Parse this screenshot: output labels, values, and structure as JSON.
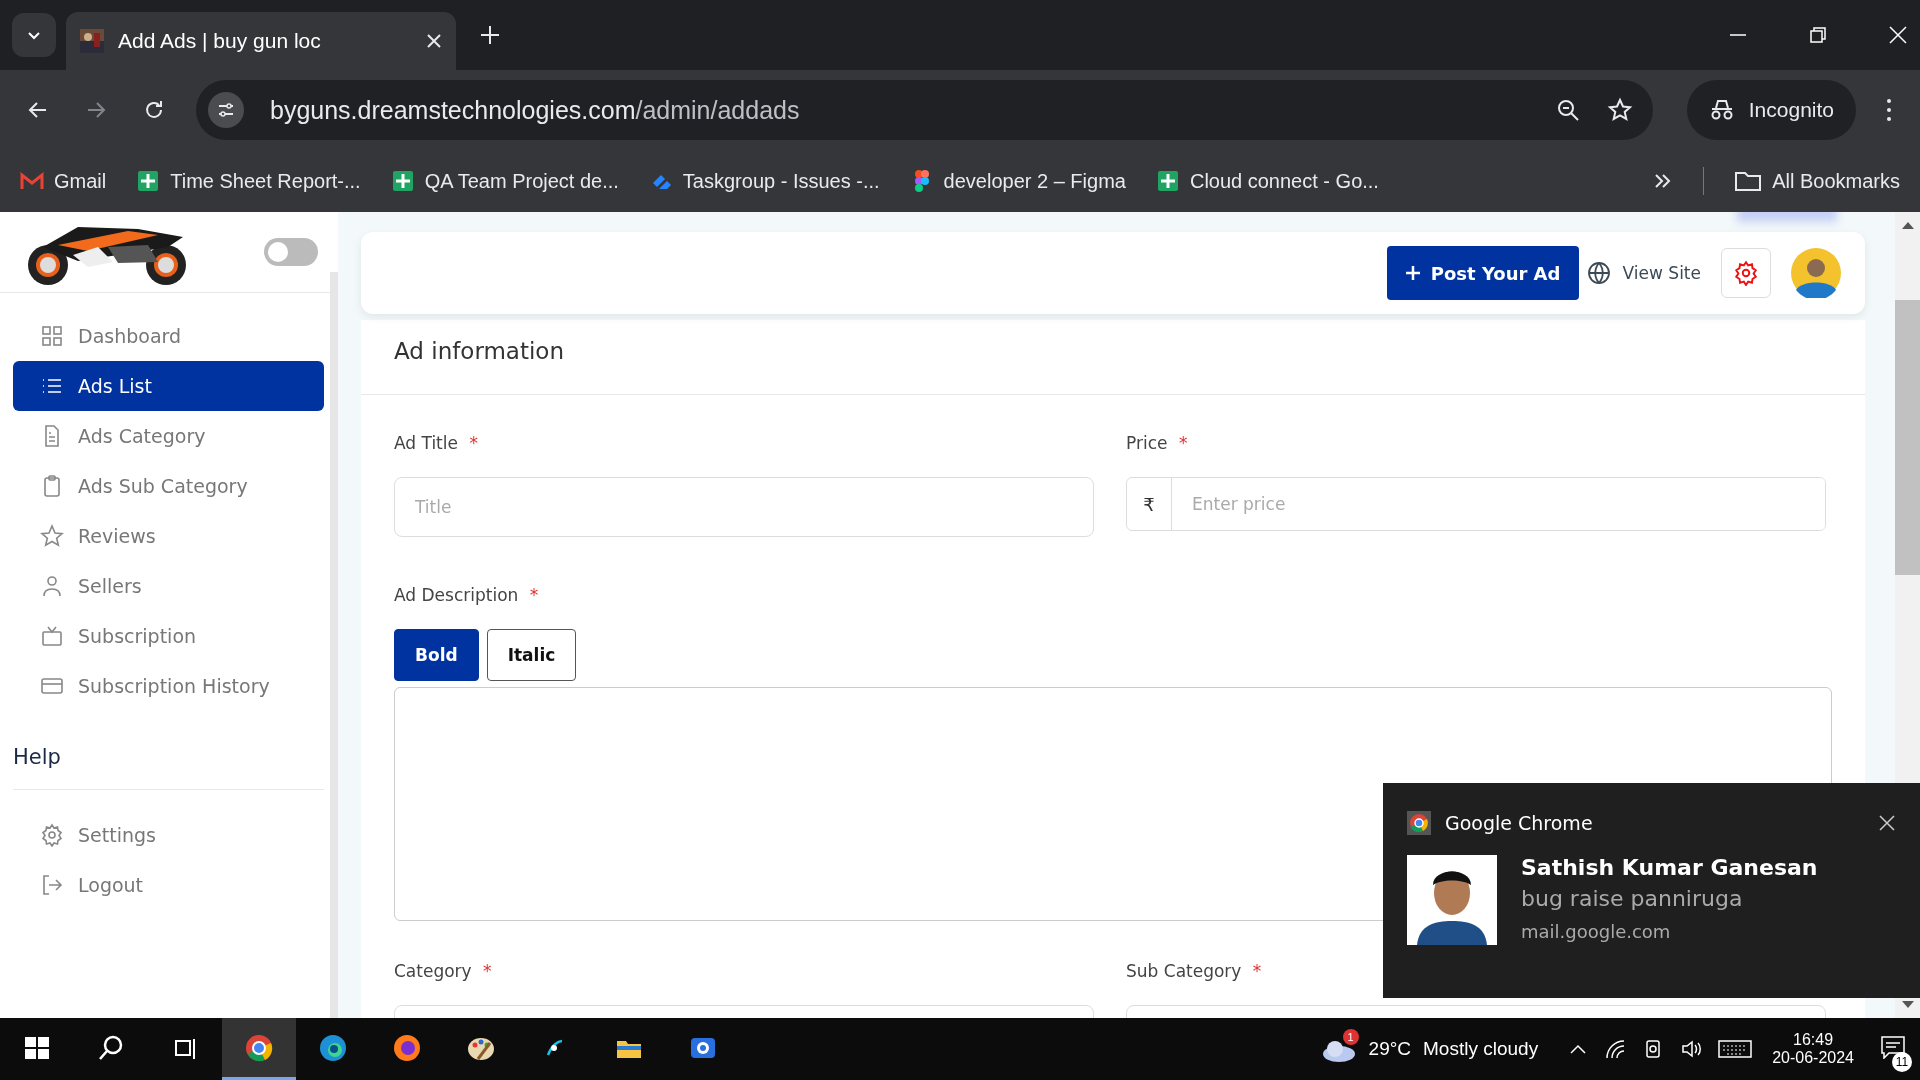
{
  "browser": {
    "tabs": [
      {
        "title": "Add Ads | buy gun loc",
        "selected": true
      }
    ],
    "url_host": "byguns.dreamstechnologies.com",
    "url_path": "/admin/addads",
    "profile": "Incognito",
    "bookmarks": [
      {
        "label": "Gmail"
      },
      {
        "label": "Time Sheet Report-..."
      },
      {
        "label": "QA Team Project de..."
      },
      {
        "label": "Taskgroup - Issues -..."
      },
      {
        "label": "developer 2 – Figma"
      },
      {
        "label": "Cloud connect - Go..."
      }
    ],
    "all_bookmarks": "All Bookmarks"
  },
  "sidebar": {
    "theme_toggle": {
      "on": false
    },
    "items": [
      {
        "label": "Dashboard",
        "selected": false
      },
      {
        "label": "Ads List",
        "selected": true
      },
      {
        "label": "Ads Category",
        "selected": false
      },
      {
        "label": "Ads Sub Category",
        "selected": false
      },
      {
        "label": "Reviews",
        "selected": false
      },
      {
        "label": "Sellers",
        "selected": false
      },
      {
        "label": "Subscription",
        "selected": false
      },
      {
        "label": "Subscription History",
        "selected": false
      }
    ],
    "help_heading": "Help",
    "bottom_items": [
      {
        "label": "Settings",
        "selected": false
      },
      {
        "label": "Logout",
        "selected": false
      }
    ]
  },
  "header": {
    "post_button": "Post Your Ad",
    "view_site": "View Site"
  },
  "form": {
    "heading": "Ad information",
    "title_label": "Ad Title",
    "title_placeholder": "Title",
    "price_label": "Price",
    "currency": "₹",
    "price_placeholder": "Enter price",
    "description_label": "Ad Description",
    "format_buttons": [
      {
        "label": "Bold",
        "selected": true
      },
      {
        "label": "Italic",
        "selected": false
      }
    ],
    "category_label": "Category",
    "sub_category_label": "Sub Category",
    "required_mark": "*"
  },
  "notification": {
    "app": "Google Chrome",
    "sender": "Sathish Kumar Ganesan",
    "message": "bug raise panniruga",
    "source": "mail.google.com"
  },
  "taskbar": {
    "apps": [
      {
        "selected": false
      },
      {
        "selected": false
      },
      {
        "selected": false
      },
      {
        "selected": true
      },
      {
        "selected": false
      },
      {
        "selected": false
      },
      {
        "selected": false
      },
      {
        "selected": false
      },
      {
        "selected": false
      },
      {
        "selected": false
      }
    ],
    "weather_badge": "1",
    "temperature": "29°C",
    "weather": "Mostly cloudy",
    "time": "16:49",
    "date": "20-06-2024",
    "notification_count": "11"
  }
}
